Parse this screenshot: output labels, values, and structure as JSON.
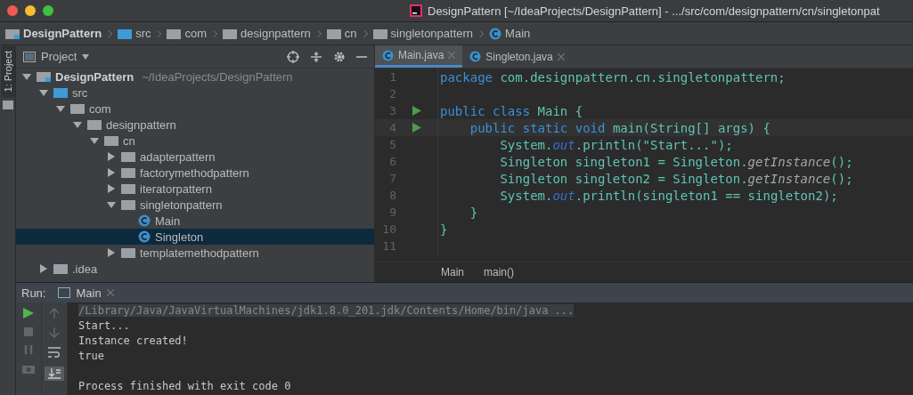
{
  "window": {
    "title": "DesignPattern [~/IdeaProjects/DesignPattern] - .../src/com/designpattern/cn/singletonpat"
  },
  "navbar": [
    {
      "label": "DesignPattern",
      "kind": "project"
    },
    {
      "label": "src",
      "kind": "source"
    },
    {
      "label": "com",
      "kind": "package"
    },
    {
      "label": "designpattern",
      "kind": "package"
    },
    {
      "label": "cn",
      "kind": "package"
    },
    {
      "label": "singletonpattern",
      "kind": "package"
    },
    {
      "label": "Main",
      "kind": "class"
    }
  ],
  "side_strip": {
    "label": "1: Project"
  },
  "project_panel": {
    "title": "Project",
    "tree": [
      {
        "label": "DesignPattern",
        "hint": "~/IdeaProjects/DesignPattern",
        "kind": "project",
        "expanded": true,
        "selected": false,
        "children": [
          {
            "label": "src",
            "kind": "source",
            "expanded": true,
            "selected": false,
            "children": [
              {
                "label": "com",
                "kind": "package",
                "expanded": true,
                "selected": false,
                "children": [
                  {
                    "label": "designpattern",
                    "kind": "package",
                    "expanded": true,
                    "selected": false,
                    "children": [
                      {
                        "label": "cn",
                        "kind": "package",
                        "expanded": true,
                        "selected": false,
                        "children": [
                          {
                            "label": "adapterpattern",
                            "kind": "package",
                            "expanded": false,
                            "selected": false
                          },
                          {
                            "label": "factorymethodpattern",
                            "kind": "package",
                            "expanded": false,
                            "selected": false
                          },
                          {
                            "label": "iteratorpattern",
                            "kind": "package",
                            "expanded": false,
                            "selected": false
                          },
                          {
                            "label": "singletonpattern",
                            "kind": "package",
                            "expanded": true,
                            "selected": false,
                            "children": [
                              {
                                "label": "Main",
                                "kind": "class",
                                "selected": false
                              },
                              {
                                "label": "Singleton",
                                "kind": "class",
                                "selected": true
                              }
                            ]
                          },
                          {
                            "label": "templatemethodpattern",
                            "kind": "package",
                            "expanded": false,
                            "selected": false
                          }
                        ]
                      }
                    ]
                  }
                ]
              }
            ]
          },
          {
            "label": ".idea",
            "kind": "package",
            "expanded": false,
            "selected": false
          }
        ]
      }
    ]
  },
  "editor": {
    "tabs": [
      {
        "label": "Main.java",
        "selected": true
      },
      {
        "label": "Singleton.java",
        "selected": false
      }
    ],
    "lines": [
      {
        "number": "1",
        "run": false,
        "current": false,
        "tokens": [
          {
            "text": "package ",
            "kind": "keyword"
          },
          {
            "text": "com.designpattern.cn.singletonpattern;",
            "kind": "plain"
          }
        ]
      },
      {
        "number": "2",
        "run": false,
        "current": false
      },
      {
        "number": "3",
        "run": true,
        "current": false,
        "tokens": [
          {
            "text": "public class ",
            "kind": "keyword"
          },
          {
            "text": "Main {",
            "kind": "plain"
          }
        ]
      },
      {
        "number": "4",
        "run": true,
        "current": true,
        "tokens": [
          {
            "text": "    public static void ",
            "kind": "keyword"
          },
          {
            "text": "main(String[] args) {",
            "kind": "plain"
          }
        ]
      },
      {
        "number": "5",
        "run": false,
        "current": false,
        "tokens": [
          {
            "text": "        System.",
            "kind": "plain"
          },
          {
            "text": "out",
            "kind": "field"
          },
          {
            "text": ".println(\"Start...\");",
            "kind": "plain"
          }
        ]
      },
      {
        "number": "6",
        "run": false,
        "current": false,
        "tokens": [
          {
            "text": "        Singleton singleton1 = Singleton.",
            "kind": "plain"
          },
          {
            "text": "getInstance",
            "kind": "method"
          },
          {
            "text": "();",
            "kind": "plain"
          }
        ]
      },
      {
        "number": "7",
        "run": false,
        "current": false,
        "tokens": [
          {
            "text": "        Singleton singleton2 = Singleton.",
            "kind": "plain"
          },
          {
            "text": "getInstance",
            "kind": "method"
          },
          {
            "text": "();",
            "kind": "plain"
          }
        ]
      },
      {
        "number": "8",
        "run": false,
        "current": false,
        "tokens": [
          {
            "text": "        System.",
            "kind": "plain"
          },
          {
            "text": "out",
            "kind": "field"
          },
          {
            "text": ".println(singleton1 == singleton2);",
            "kind": "plain"
          }
        ]
      },
      {
        "number": "9",
        "run": false,
        "current": false,
        "tokens": [
          {
            "text": "    }",
            "kind": "plain"
          }
        ]
      },
      {
        "number": "10",
        "run": false,
        "current": false,
        "tokens": [
          {
            "text": "}",
            "kind": "plain"
          }
        ]
      },
      {
        "number": "11",
        "run": false,
        "current": false
      }
    ],
    "breadcrumb": [
      "Main",
      "main()"
    ]
  },
  "run_panel": {
    "label": "Run:",
    "tab": "Main",
    "console": [
      {
        "text": "/Library/Java/JavaVirtualMachines/jdk1.8.0_201.jdk/Contents/Home/bin/java ...",
        "kind": "command"
      },
      {
        "text": "Start...",
        "kind": "output"
      },
      {
        "text": "Instance created!",
        "kind": "output"
      },
      {
        "text": "true",
        "kind": "output"
      },
      {
        "kind": "blank"
      },
      {
        "text": "Process finished with exit code 0",
        "kind": "output"
      }
    ]
  }
}
